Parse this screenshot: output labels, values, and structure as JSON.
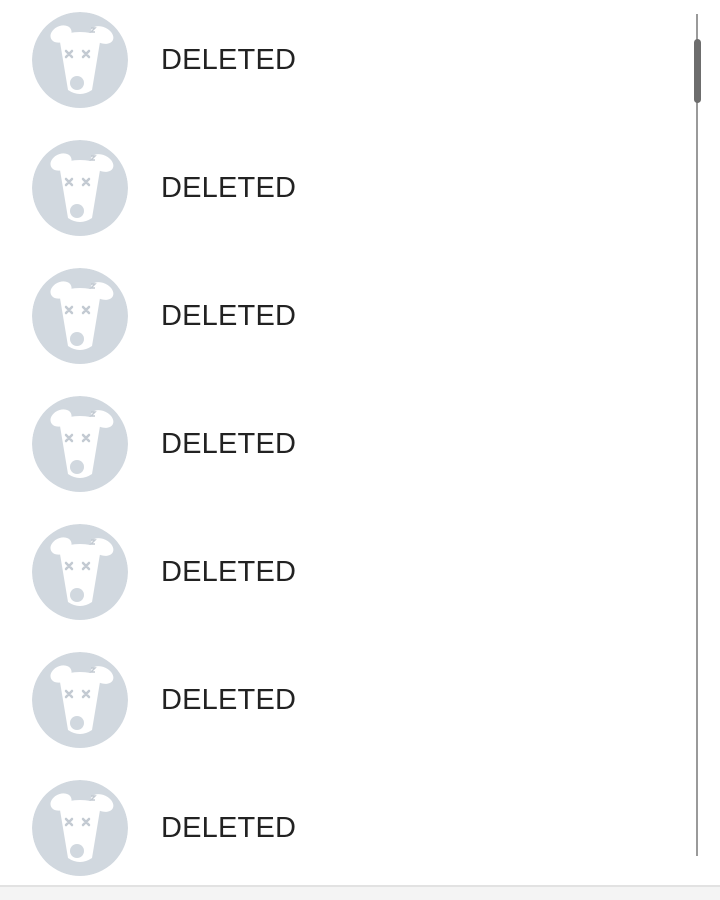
{
  "friends_list": {
    "items": [
      {
        "name": "DELETED",
        "avatar_icon": "deleted-user-dog-icon"
      },
      {
        "name": "DELETED",
        "avatar_icon": "deleted-user-dog-icon"
      },
      {
        "name": "DELETED",
        "avatar_icon": "deleted-user-dog-icon"
      },
      {
        "name": "DELETED",
        "avatar_icon": "deleted-user-dog-icon"
      },
      {
        "name": "DELETED",
        "avatar_icon": "deleted-user-dog-icon"
      },
      {
        "name": "DELETED",
        "avatar_icon": "deleted-user-dog-icon"
      },
      {
        "name": "DELETED",
        "avatar_icon": "deleted-user-dog-icon"
      }
    ]
  },
  "colors": {
    "avatar_bg": "#d1d8df",
    "avatar_fg": "#ffffff",
    "avatar_eyes": "#c3cad2",
    "name_text": "#222222",
    "scrollbar_track": "#9a9a9a",
    "scrollbar_thumb": "#6d6d6d"
  },
  "scroll": {
    "position_fraction": 0.0
  }
}
